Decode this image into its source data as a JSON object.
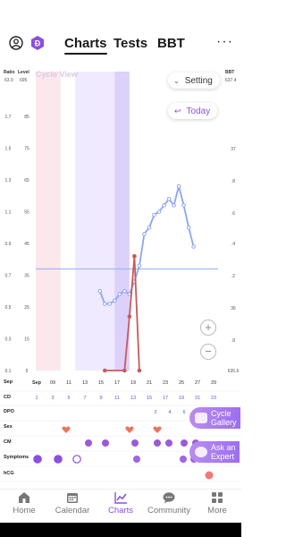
{
  "header": {
    "tabs": [
      {
        "label": "Charts",
        "active": true
      },
      {
        "label": "Tests",
        "active": false
      },
      {
        "label": "BBT",
        "active": false
      }
    ],
    "more_label": "···"
  },
  "chart_header": {
    "left_axis_titles": [
      "Ratio",
      "Level"
    ],
    "right_axis_title": "BBT",
    "left_top_values": [
      "63.9",
      "695"
    ],
    "right_top_value": "637.4",
    "view_label": "Cycle View",
    "setting_label": "Setting",
    "today_label": "Today"
  },
  "chart_data": {
    "type": "line",
    "left_ratio_ticks": [
      "1.7",
      "1.5",
      "1.3",
      "1.1",
      "0.9",
      "0.7",
      "0.5",
      "0.3",
      "0.1"
    ],
    "left_level_ticks": [
      "85",
      "75",
      "65",
      "55",
      "45",
      "35",
      "25",
      "15",
      "5"
    ],
    "right_ticks": [
      "37",
      ".8",
      ".6",
      ".4",
      ".2",
      "36",
      ".8",
      "635.6"
    ],
    "x": [
      "Sep",
      "09",
      "11",
      "13",
      "15",
      "17",
      "19",
      "21",
      "23",
      "25",
      "27",
      "29"
    ],
    "cd": [
      "1",
      "3",
      "5",
      "7",
      "9",
      "11",
      "13",
      "15",
      "17",
      "19",
      "21",
      "23"
    ],
    "dpo": [
      "2",
      "4",
      "6"
    ],
    "baseline_level": 35,
    "series": [
      {
        "color": "#8ea6ee",
        "points": [
          [
            14,
            30
          ],
          [
            15,
            26
          ],
          [
            16,
            26
          ],
          [
            17,
            27
          ],
          [
            18,
            29
          ],
          [
            19,
            30
          ],
          [
            20,
            29
          ],
          [
            21,
            33
          ],
          [
            22,
            38
          ],
          [
            23,
            48
          ],
          [
            24,
            50
          ],
          [
            25,
            54
          ],
          [
            26,
            55
          ],
          [
            27,
            57
          ],
          [
            28,
            59
          ],
          [
            29,
            57
          ],
          [
            30,
            63
          ],
          [
            31,
            57
          ],
          [
            32,
            50
          ],
          [
            33,
            44
          ]
        ]
      },
      {
        "color": "#c65b5b",
        "points": [
          [
            15,
            5
          ],
          [
            19,
            5
          ],
          [
            20,
            22
          ],
          [
            21,
            41
          ],
          [
            22,
            5
          ]
        ]
      }
    ],
    "bands": [
      {
        "color": "#fbe7ec",
        "from": 1,
        "to": 6
      },
      {
        "color": "#efeaff",
        "from": 9,
        "to": 19
      },
      {
        "color": "#ddd0fb",
        "from": 17,
        "to": 20
      }
    ]
  },
  "rows": {
    "labels": [
      "Sep",
      "CD",
      "DPO",
      "Sex",
      "CM",
      "Symptoms",
      "hCG"
    ]
  },
  "side_buttons": {
    "gallery": [
      "Cycle",
      "Gallery"
    ],
    "expert": [
      "Ask an",
      "Expert"
    ]
  },
  "nav": [
    {
      "label": "Home",
      "icon": "home-icon"
    },
    {
      "label": "Calendar",
      "icon": "calendar-icon"
    },
    {
      "label": "Charts",
      "icon": "charts-icon",
      "active": true
    },
    {
      "label": "Community",
      "icon": "community-icon"
    },
    {
      "label": "More",
      "icon": "more-grid-icon"
    }
  ]
}
